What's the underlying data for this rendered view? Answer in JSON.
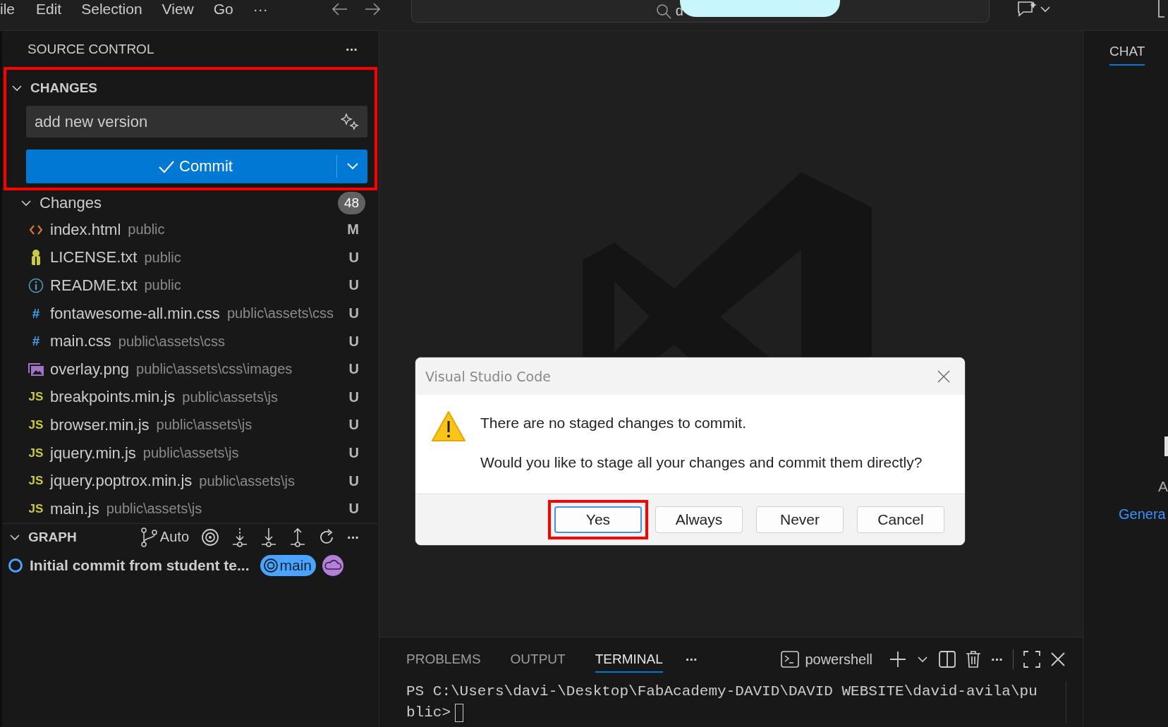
{
  "menu_bar": {
    "items": [
      "ile",
      "Edit",
      "Selection",
      "View",
      "Go",
      "···"
    ]
  },
  "command_center": {
    "value": "d",
    "redacted": true
  },
  "source_control": {
    "title": "SOURCE CONTROL",
    "more": "···",
    "changes_section": {
      "title": "CHANGES",
      "expanded": true,
      "annotated": true,
      "message": "add new version",
      "commit_label": "Commit"
    },
    "changes_group": {
      "label": "Changes",
      "expanded": true,
      "count": "48",
      "files": [
        {
          "kind": "html",
          "name": "index.html",
          "path": "public",
          "status": "M"
        },
        {
          "kind": "license",
          "name": "LICENSE.txt",
          "path": "public",
          "status": "U"
        },
        {
          "kind": "info",
          "name": "README.txt",
          "path": "public",
          "status": "U"
        },
        {
          "kind": "css",
          "icon": "#",
          "name": "fontawesome-all.min.css",
          "path": "public\\assets\\css",
          "status": "U"
        },
        {
          "kind": "css",
          "icon": "#",
          "name": "main.css",
          "path": "public\\assets\\css",
          "status": "U"
        },
        {
          "kind": "image",
          "name": "overlay.png",
          "path": "public\\assets\\css\\images",
          "status": "U"
        },
        {
          "kind": "js",
          "icon": "JS",
          "name": "breakpoints.min.js",
          "path": "public\\assets\\js",
          "status": "U"
        },
        {
          "kind": "js",
          "icon": "JS",
          "name": "browser.min.js",
          "path": "public\\assets\\js",
          "status": "U"
        },
        {
          "kind": "js",
          "icon": "JS",
          "name": "jquery.min.js",
          "path": "public\\assets\\js",
          "status": "U"
        },
        {
          "kind": "js",
          "icon": "JS",
          "name": "jquery.poptrox.min.js",
          "path": "public\\assets\\js",
          "status": "U"
        },
        {
          "kind": "js",
          "icon": "JS",
          "name": "main.js",
          "path": "public\\assets\\js",
          "status": "U"
        }
      ]
    },
    "graph": {
      "title": "GRAPH",
      "expanded": true,
      "branch_mode": "Auto",
      "more": "···",
      "commits": [
        {
          "message": "Initial commit from student te...",
          "branch": "main"
        }
      ]
    }
  },
  "dialog": {
    "title": "Visual Studio Code",
    "message": "There are no staged changes to commit.",
    "question": "Would you like to stage all your changes and commit them directly?",
    "buttons": [
      {
        "label": "Yes",
        "focused": true,
        "annotated": true
      },
      {
        "label": "Always",
        "focused": false,
        "annotated": false
      },
      {
        "label": "Never",
        "focused": false,
        "annotated": false
      },
      {
        "label": "Cancel",
        "focused": false,
        "annotated": false
      }
    ]
  },
  "panel": {
    "tabs": [
      {
        "label": "PROBLEMS",
        "selected": false
      },
      {
        "label": "OUTPUT",
        "selected": false
      },
      {
        "label": "TERMINAL",
        "selected": true
      }
    ],
    "more": "···",
    "terminal_name": "powershell",
    "actions_more": "···",
    "terminal_lines": [
      "PS C:\\Users\\davi-\\Desktop\\FabAcademy-DAVID\\DAVID WEBSITE\\david-avila\\pu",
      "blic>"
    ]
  },
  "chat": {
    "tab": {
      "label": "CHAT",
      "selected": true
    },
    "fragment": "A",
    "link": "Genera"
  }
}
